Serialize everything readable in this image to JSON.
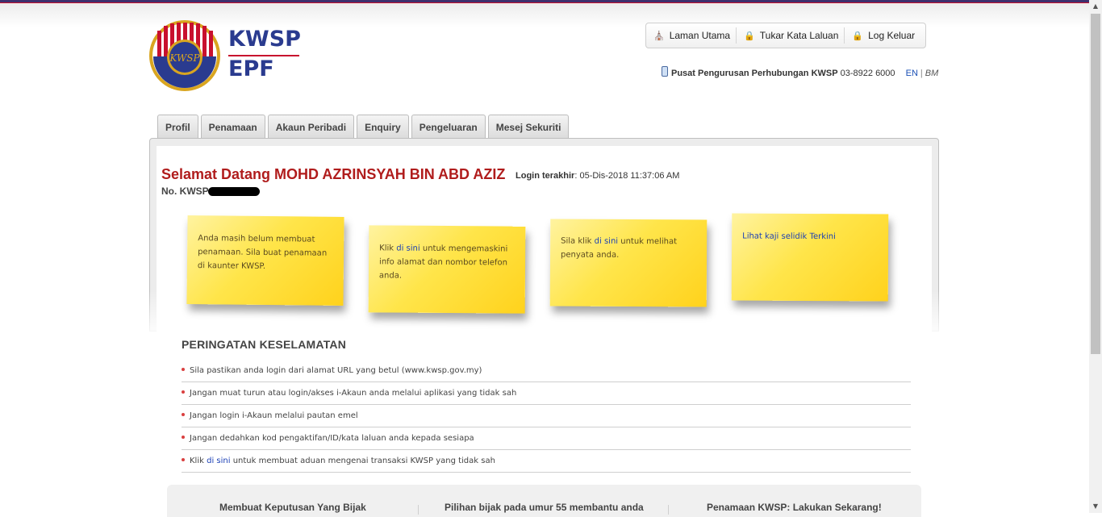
{
  "brand": {
    "name_primary": "KWSP",
    "name_secondary": "EPF",
    "seal_text": "KWSP",
    "colors": {
      "blue": "#2a3b8f",
      "red": "#c8102e",
      "gold": "#d9a520"
    }
  },
  "topnav": {
    "items": [
      {
        "label": "Laman Utama",
        "icon": "home-icon"
      },
      {
        "label": "Tukar Kata Laluan",
        "icon": "lock-icon"
      },
      {
        "label": "Log Keluar",
        "icon": "lock-icon"
      }
    ]
  },
  "contact": {
    "label": "Pusat Pengurusan Perhubungan KWSP",
    "phone": "03-8922 6000",
    "lang_en": "EN",
    "lang_sep": "|",
    "lang_bm": "BM"
  },
  "tabs": [
    "Profil",
    "Penamaan",
    "Akaun Peribadi",
    "Enquiry",
    "Pengeluaran",
    "Mesej Sekuriti"
  ],
  "welcome": {
    "greeting": "Selamat Datang MOHD AZRINSYAH BIN ABD AZIZ",
    "last_login_label": "Login terakhir",
    "last_login_value": ": 05-Dis-2018 11:37:06 AM",
    "kwsp_no_label": "No. KWSP"
  },
  "notes": {
    "note1": {
      "text": "Anda masih belum membuat penamaan. Sila buat penamaan di kaunter KWSP."
    },
    "note2": {
      "before": "Klik ",
      "link": "di sini",
      "after": "  untuk mengemaskini info alamat dan nombor telefon anda."
    },
    "note3": {
      "before": "Sila klik ",
      "link": "di sini",
      "after": " untuk melihat penyata anda."
    },
    "note4": {
      "link": "Lihat kaji selidik Terkini"
    }
  },
  "security": {
    "title": "PERINGATAN KESELAMATAN",
    "items": [
      "Sila pastikan anda login dari alamat URL yang betul (www.kwsp.gov.my)",
      "Jangan muat turun atau login/akses i-Akaun anda melalui aplikasi yang tidak sah",
      "Jangan login i-Akaun melalui pautan emel",
      "Jangan dedahkan kod pengaktifan/ID/kata laluan anda kepada sesiapa"
    ],
    "last_item": {
      "before": "Klik ",
      "link": "di sini",
      "after": " untuk membuat aduan mengenai transaksi KWSP yang tidak sah"
    }
  },
  "bottom": {
    "items": [
      "Membuat Keputusan Yang Bijak",
      "Pilihan bijak pada umur 55 membantu anda",
      "Penamaan KWSP: Lakukan Sekarang!"
    ]
  }
}
